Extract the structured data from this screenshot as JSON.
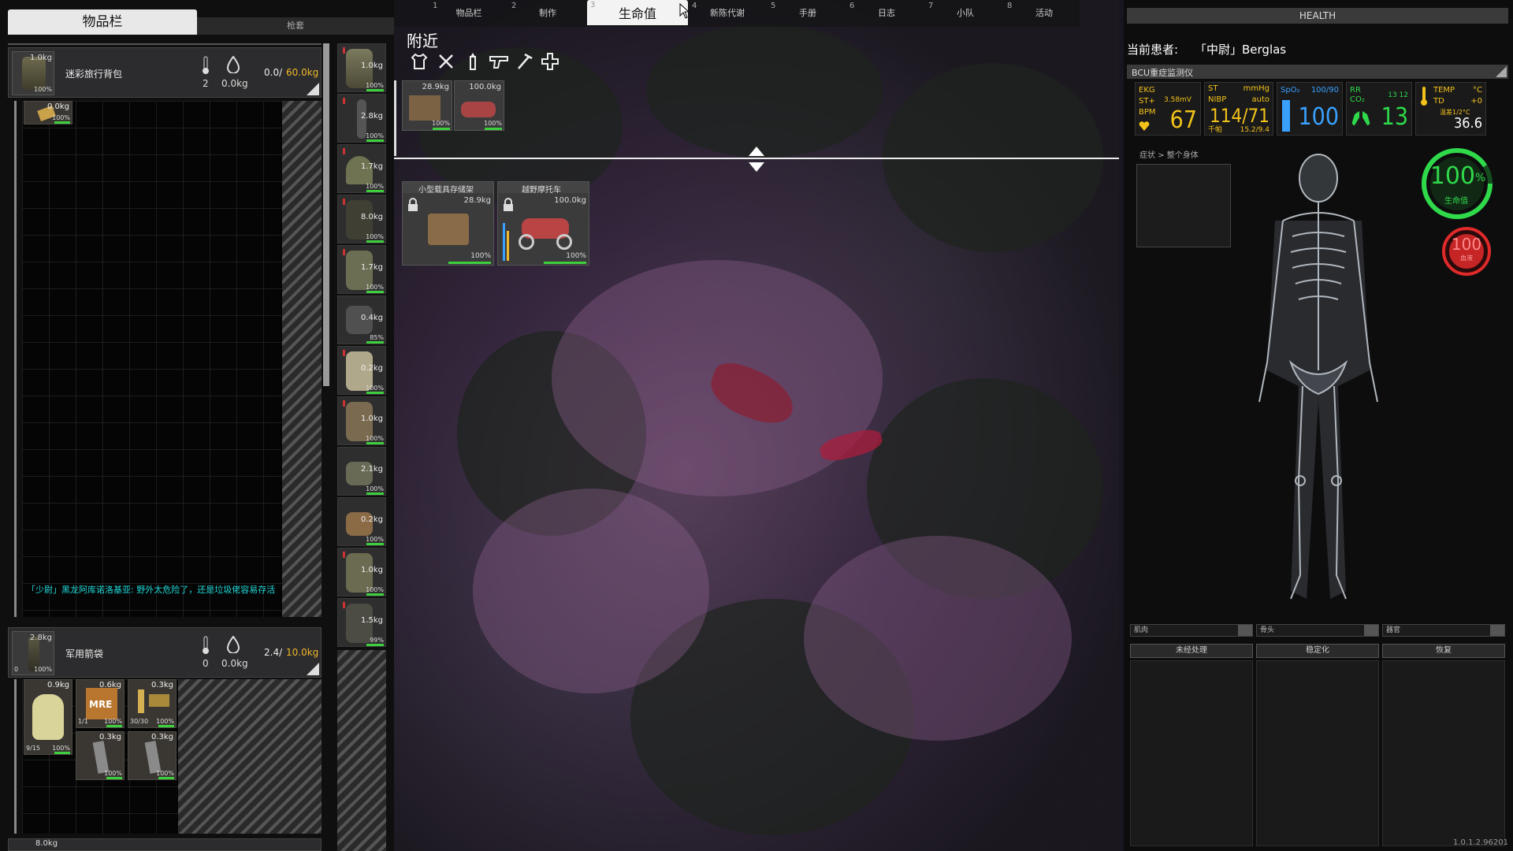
{
  "top_tabs": [
    {
      "num": "1",
      "label": "物品栏"
    },
    {
      "num": "2",
      "label": "制作"
    },
    {
      "num": "3",
      "label": "生命值"
    },
    {
      "num": "4",
      "label": "新陈代谢"
    },
    {
      "num": "5",
      "label": "手册"
    },
    {
      "num": "6",
      "label": "日志"
    },
    {
      "num": "7",
      "label": "小队"
    },
    {
      "num": "8",
      "label": "活动"
    }
  ],
  "left": {
    "tab_active": "物品栏",
    "tab_other": "枪套",
    "backpack": {
      "weight": "1.0kg",
      "name": "迷彩旅行背包",
      "temp": "2",
      "water": "0.0kg",
      "cap_used": "0.0/",
      "cap_max": "60.0kg",
      "durability": "100%"
    },
    "backpack_item": {
      "weight": "0.0kg",
      "durability": "100%"
    },
    "chat_message": "「少尉」黑龙阿库诺洛基亚: 野外太危险了，还是垃圾佬容易存活",
    "quiver": {
      "weight": "2.8kg",
      "name": "军用箭袋",
      "temp": "0",
      "water": "0.0kg",
      "cap_used": "2.4/",
      "cap_max": "10.0kg",
      "durability": "100%",
      "count": "0"
    },
    "quiver_items": [
      {
        "weight": "0.9kg",
        "durability": "100%",
        "count": "9/15"
      },
      {
        "weight": "0.6kg",
        "durability": "100%",
        "count": "1/1"
      },
      {
        "weight": "0.3kg",
        "durability": "100%",
        "count": "30/30"
      },
      {
        "weight": "0.3kg",
        "durability": "100%",
        "count": ""
      },
      {
        "weight": "0.3kg",
        "durability": "100%",
        "count": ""
      }
    ],
    "bottom_weight": "8.0kg"
  },
  "equipment": [
    {
      "weight": "1.0kg",
      "durability": "100%"
    },
    {
      "weight": "2.8kg",
      "durability": "100%"
    },
    {
      "weight": "1.7kg",
      "durability": "100%"
    },
    {
      "weight": "8.0kg",
      "durability": "100%"
    },
    {
      "weight": "1.7kg",
      "durability": "100%"
    },
    {
      "weight": "0.4kg",
      "durability": "85%"
    },
    {
      "weight": "0.2kg",
      "durability": "100%"
    },
    {
      "weight": "1.0kg",
      "durability": "100%"
    },
    {
      "weight": "2.1kg",
      "durability": "100%"
    },
    {
      "weight": "0.2kg",
      "durability": "100%"
    },
    {
      "weight": "1.0kg",
      "durability": "100%"
    },
    {
      "weight": "1.5kg",
      "durability": "99%"
    }
  ],
  "nearby": {
    "title": "附近",
    "small_items": [
      {
        "weight": "28.9kg",
        "durability": "100%"
      },
      {
        "weight": "100.0kg",
        "durability": "100%"
      }
    ],
    "containers": [
      {
        "name": "小型载具存储架",
        "weight": "28.9kg",
        "durability": "100%"
      },
      {
        "name": "越野摩托车",
        "weight": "100.0kg",
        "durability": "100%"
      }
    ]
  },
  "health": {
    "header": "HEALTH",
    "patient_label": "当前患者:",
    "patient_name": "「中尉」Berglas",
    "monitor_title": "BCU重症监测仪",
    "vitals": {
      "ekg_label": "EKG",
      "st_label": "ST+",
      "st_value": "3.58mV",
      "bpm_label": "BPM",
      "bpm": "67",
      "nibp_st": "ST",
      "nibp_unit": "mmHg",
      "nibp_label": "NIBP",
      "nibp_mode": "auto",
      "nibp_value": "114/71",
      "nibp_sub_label": "千帕",
      "nibp_sub": "15.2/9.4",
      "spo2_label": "SpO₂",
      "spo2_range": "100/90",
      "spo2": "100",
      "rr_label": "RR",
      "co2_label": "CO₂",
      "rr_small": "13 12",
      "rr": "13",
      "temp_label": "TEMP",
      "temp_unit": "°C",
      "td_label": "TD",
      "td_value": "+0",
      "temp_sub": "温差1/2°C",
      "temp": "36.6"
    },
    "symptom_breadcrumb": "症状 > 整个身体",
    "life_percent": "100",
    "life_unit": "%",
    "life_label": "生命值",
    "blood_value": "100",
    "blood_label": "血液",
    "body_selects": [
      "肌肉",
      "骨头",
      "器官"
    ],
    "actions": [
      "未经处理",
      "稳定化",
      "恢复"
    ],
    "colors": {
      "green": "#2fd94a",
      "red": "#e02a2a",
      "amber": "#f3c21a",
      "blue": "#3aa0ff"
    }
  },
  "version": "1.0.1.2.96201"
}
